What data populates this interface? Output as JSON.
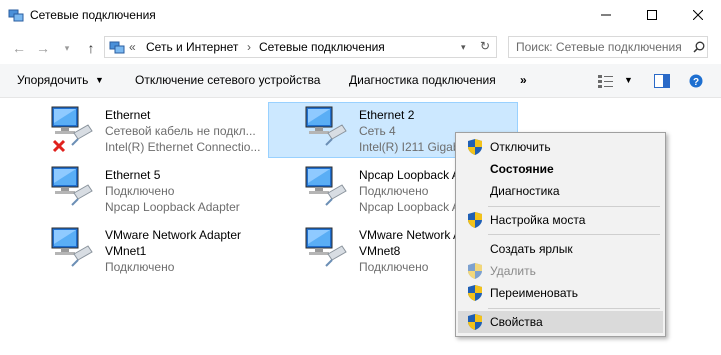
{
  "window": {
    "title": "Сетевые подключения"
  },
  "address": {
    "prefix": "«",
    "crumbs": [
      "Сеть и Интернет",
      "Сетевые подключения"
    ]
  },
  "search": {
    "placeholder": "Поиск: Сетевые подключения"
  },
  "toolbar": {
    "organize": "Упорядочить",
    "disable_device": "Отключение сетевого устройства",
    "diagnose": "Диагностика подключения",
    "more": "»"
  },
  "connections": [
    {
      "name": "Ethernet",
      "status": "Сетевой кабель не подкл...",
      "device": "Intel(R) Ethernet Connectio...",
      "error": true
    },
    {
      "name": "Ethernet 2",
      "status": "Сеть  4",
      "device": "Intel(R) I211 Gigab",
      "selected": true
    },
    {
      "name": "Ethernet 5",
      "status": "Подключено",
      "device": "Npcap Loopback Adapter"
    },
    {
      "name": "Npcap Loopback A",
      "status": "Подключено",
      "device": "Npcap Loopback A"
    },
    {
      "name": "VMware Network Adapter",
      "status": "VMnet1",
      "device": "Подключено"
    },
    {
      "name": "VMware Network A",
      "status": "VMnet8",
      "device": "Подключено"
    }
  ],
  "context_menu": {
    "disable": "Отключить",
    "status": "Состояние",
    "diagnostics": "Диагностика",
    "bridge": "Настройка моста",
    "shortcut": "Создать ярлык",
    "delete": "Удалить",
    "rename": "Переименовать",
    "properties": "Свойства"
  }
}
